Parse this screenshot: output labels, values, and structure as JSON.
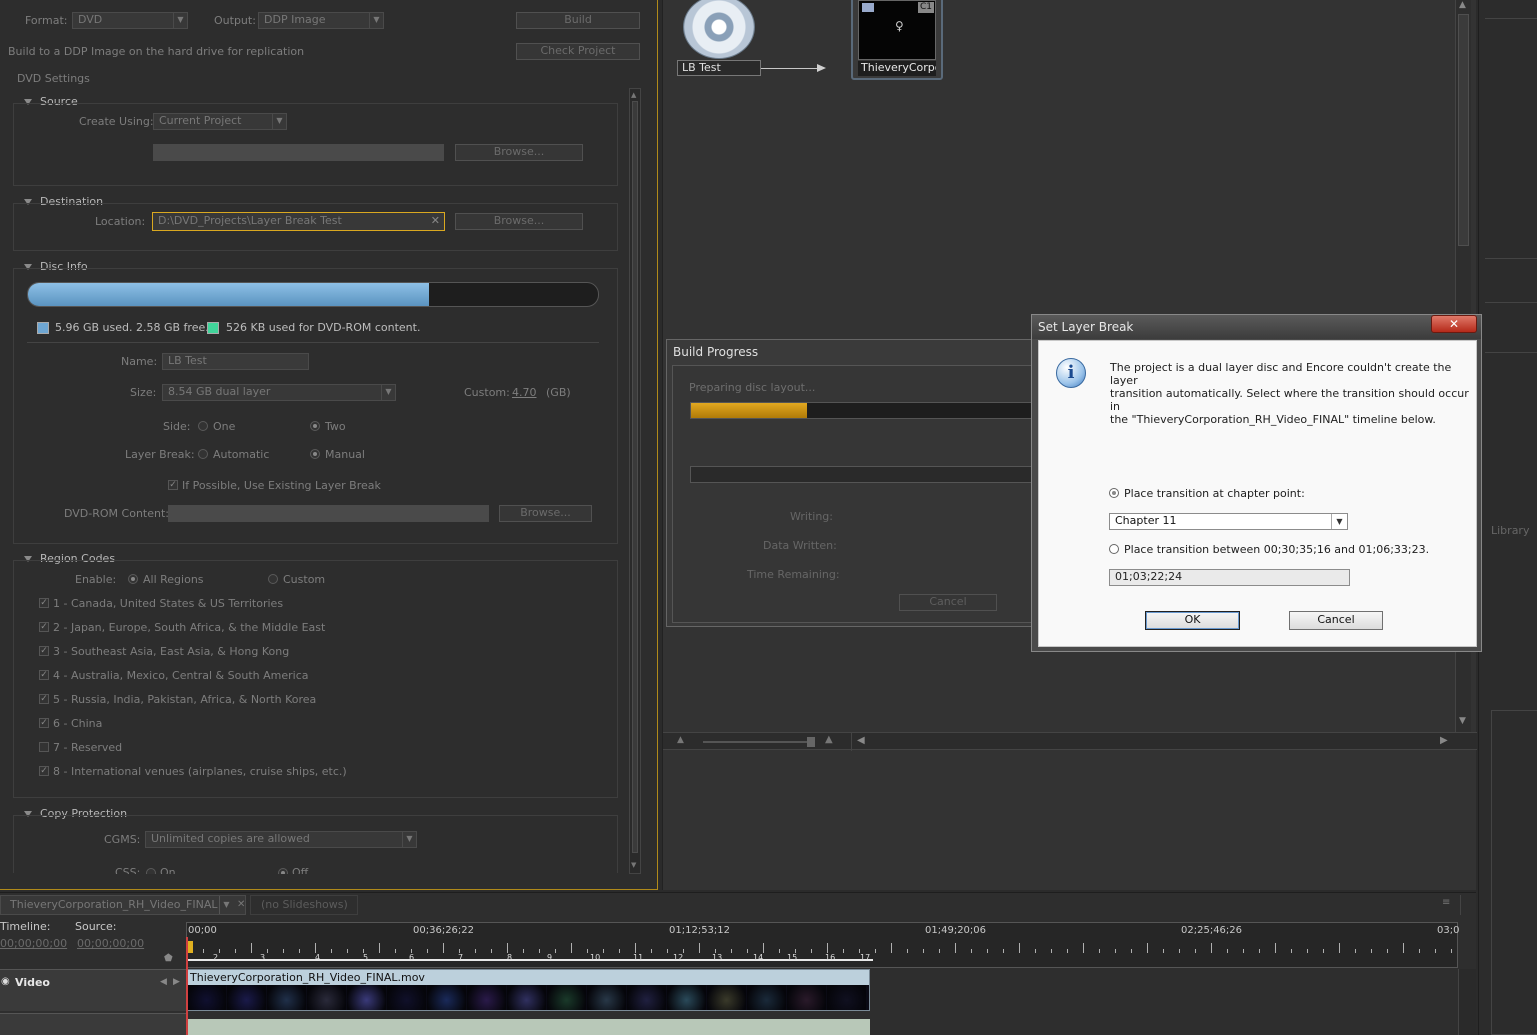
{
  "build": {
    "format_label": "Format:",
    "format_value": "DVD",
    "output_label": "Output:",
    "output_value": "DDP Image",
    "build_button": "Build",
    "description": "Build to a DDP Image on the hard drive for replication",
    "check_project_button": "Check Project",
    "dvd_settings": "DVD Settings"
  },
  "source": {
    "title": "Source",
    "create_using_label": "Create Using:",
    "create_using_value": "Current Project",
    "browse": "Browse..."
  },
  "destination": {
    "title": "Destination",
    "location_label": "Location:",
    "location_value": "D:\\DVD_Projects\\Layer Break Test",
    "browse": "Browse..."
  },
  "disc_info": {
    "title": "Disc Info",
    "used_fraction": 0.703,
    "legend_used": "5.96 GB used.  2.58 GB free.",
    "legend_rom": "526 KB used for DVD-ROM content.",
    "name_label": "Name:",
    "name_value": "LB Test",
    "size_label": "Size:",
    "size_value": "8.54 GB dual layer",
    "custom_label": "Custom:",
    "custom_value": "4.70",
    "custom_unit": "(GB)",
    "side_label": "Side:",
    "side_one": "One",
    "side_two": "Two",
    "layer_break_label": "Layer Break:",
    "lb_automatic": "Automatic",
    "lb_manual": "Manual",
    "existing_lb": "If Possible, Use Existing Layer Break",
    "dvd_rom_label": "DVD-ROM Content:",
    "browse": "Browse..."
  },
  "region": {
    "title": "Region Codes",
    "enable_label": "Enable:",
    "all_regions": "All Regions",
    "custom": "Custom",
    "items": [
      {
        "label": "1 - Canada, United States & US Territories",
        "checked": true
      },
      {
        "label": "2 - Japan, Europe, South Africa, & the Middle East",
        "checked": true
      },
      {
        "label": "3 - Southeast Asia, East Asia, & Hong Kong",
        "checked": true
      },
      {
        "label": "4 - Australia, Mexico, Central & South America",
        "checked": true
      },
      {
        "label": "5 - Russia, India, Pakistan, Africa, & North Korea",
        "checked": true
      },
      {
        "label": "6 - China",
        "checked": true
      },
      {
        "label": "7 - Reserved",
        "checked": false
      },
      {
        "label": "8 - International venues (airplanes, cruise ships, etc.)",
        "checked": true
      }
    ]
  },
  "copy_protection": {
    "title": "Copy Protection",
    "cgms_label": "CGMS:",
    "cgms_value": "Unlimited copies are allowed",
    "css_label": "CSS:",
    "css_on": "On",
    "css_off": "Off"
  },
  "flowchart": {
    "disc_label": "LB Test",
    "timeline_label": "ThieveryCorpo",
    "chapter_badge": "C1"
  },
  "build_progress": {
    "title": "Build Progress",
    "status": "Preparing disc layout...",
    "progress_fraction": 0.34,
    "writing_label": "Writing:",
    "data_written_label": "Data Written:",
    "time_remaining_label": "Time Remaining:",
    "cancel": "Cancel"
  },
  "dialog": {
    "title": "Set Layer Break",
    "close": "✕",
    "message_1": "The project is a dual layer disc and Encore couldn't create the layer",
    "message_2": "transition automatically. Select where the transition should occur in",
    "message_3": "the \"ThieveryCorporation_RH_Video_FINAL\" timeline below.",
    "option_chapter": "Place transition at chapter point:",
    "chapter_value": "Chapter 11",
    "option_between": "Place transition between 00;30;35;16 and 01;06;33;23.",
    "time_value": "01;03;22;24",
    "ok": "OK",
    "cancel": "Cancel"
  },
  "right_panel": {
    "library_tab": "Library"
  },
  "timeline": {
    "tab_name": "ThieveryCorporation_RH_Video_FINAL",
    "slideshows_tab": "(no Slideshows)",
    "timeline_label": "Timeline:",
    "source_label": "Source:",
    "timeline_tc": "00;00;00;00",
    "source_tc": "00;00;00;00",
    "ruler": [
      "00;00",
      "00;36;26;22",
      "01;12;53;12",
      "01;49;20;06",
      "02;25;46;26",
      "03;0"
    ],
    "track_name": "Video",
    "clip_name": "ThieveryCorporation_RH_Video_FINAL.mov",
    "chapters": [
      "2",
      "3",
      "4",
      "5",
      "6",
      "7",
      "8",
      "9",
      "10",
      "11",
      "12",
      "13",
      "14",
      "15",
      "16",
      "17"
    ]
  },
  "colors": {
    "disc_used": "#6ea6d2",
    "rom_green": "#41d49a",
    "progress_gold": "#c8910e",
    "focus_yellow": "#d9a820"
  }
}
